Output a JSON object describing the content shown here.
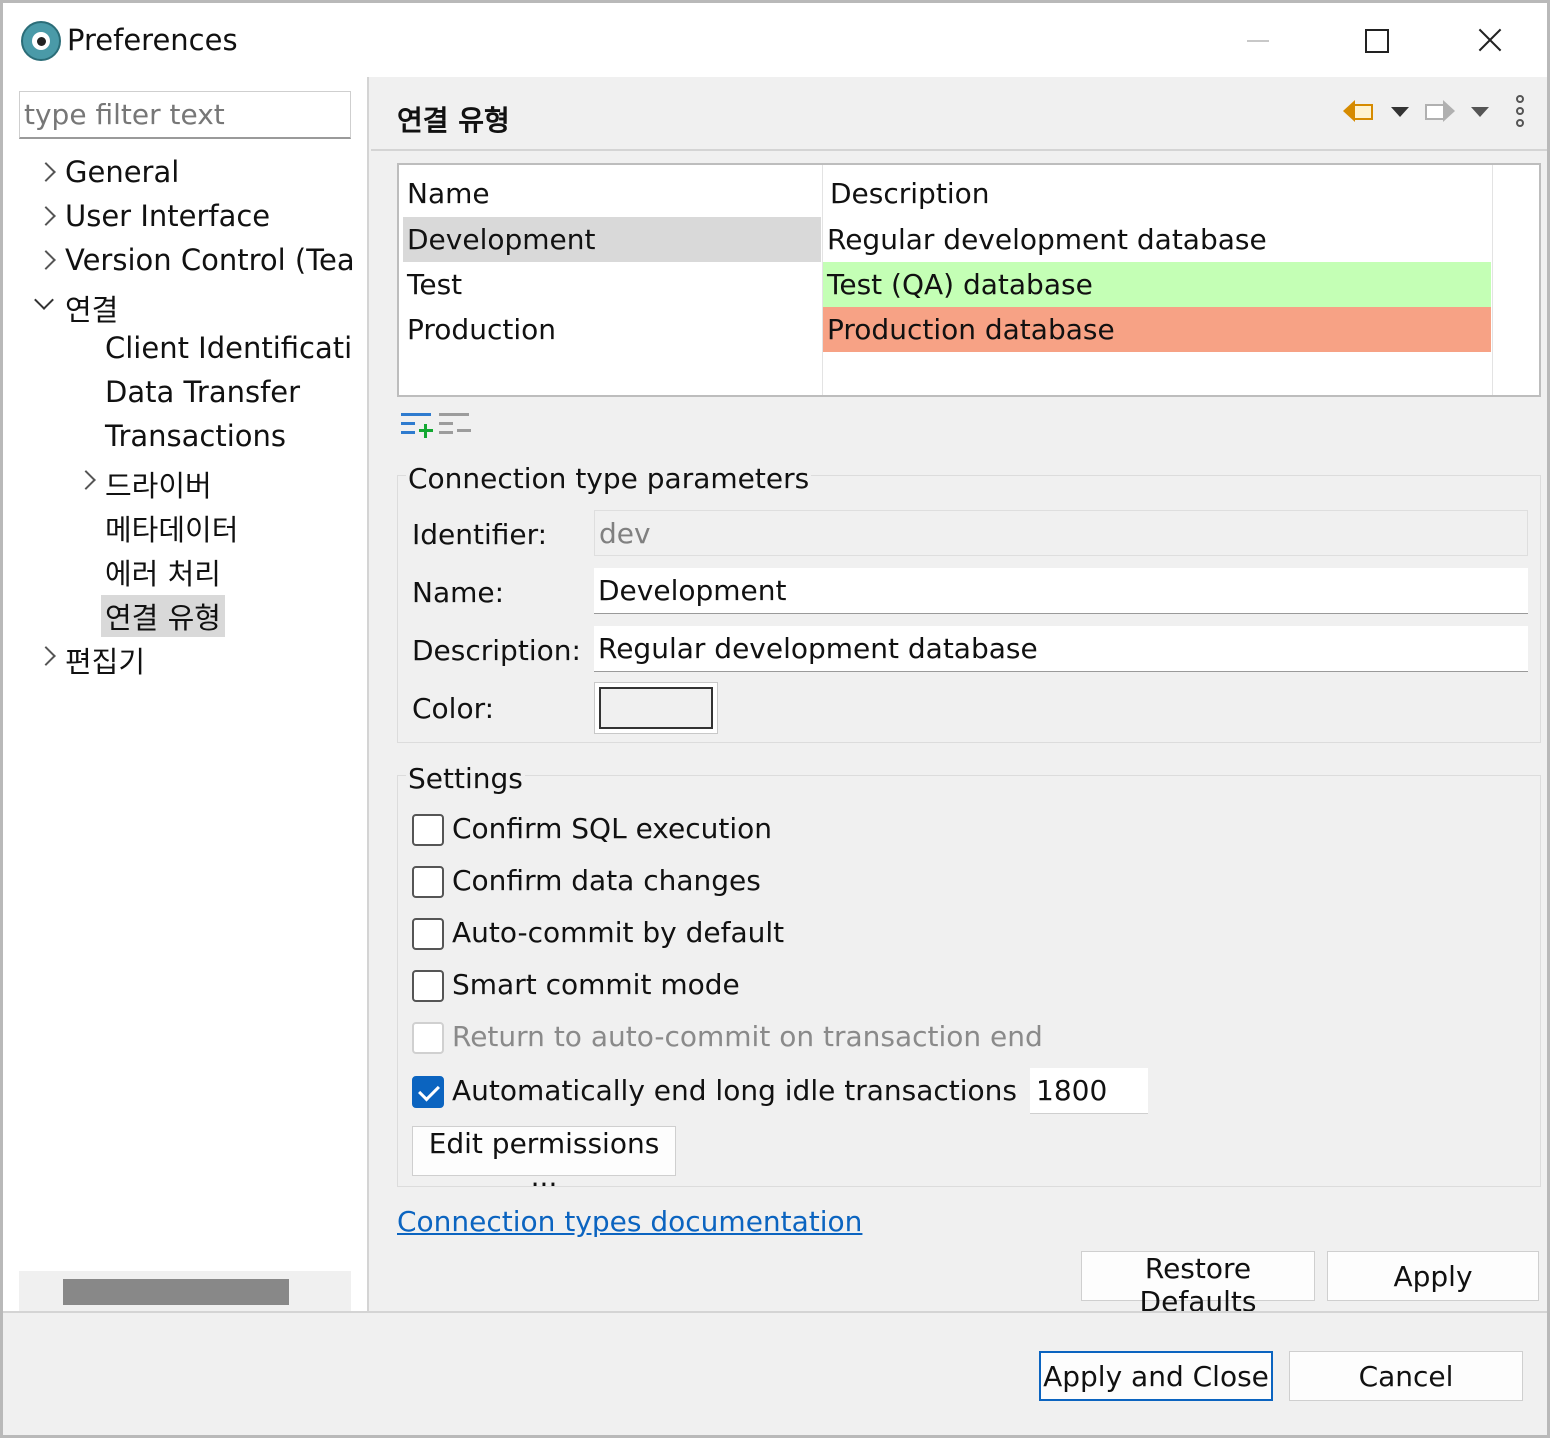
{
  "window": {
    "title": "Preferences"
  },
  "sidebar": {
    "filter_placeholder": "type filter text",
    "items": [
      {
        "label": "General"
      },
      {
        "label": "User Interface"
      },
      {
        "label": "Version Control (Tear"
      },
      {
        "label": "연결"
      },
      {
        "label": "Client Identificatio"
      },
      {
        "label": "Data Transfer"
      },
      {
        "label": "Transactions"
      },
      {
        "label": "드라이버"
      },
      {
        "label": "메타데이터"
      },
      {
        "label": "에러 처리"
      },
      {
        "label": "연결 유형"
      },
      {
        "label": "편집기"
      }
    ]
  },
  "page": {
    "title": "연결 유형"
  },
  "table": {
    "columns": [
      "Name",
      "Description"
    ],
    "rows": [
      {
        "name": "Development",
        "description": "Regular development database",
        "color": "#ffffff"
      },
      {
        "name": "Test",
        "description": "Test (QA) database",
        "color": "#c4ffb5"
      },
      {
        "name": "Production",
        "description": "Production database",
        "color": "#f7a285"
      }
    ]
  },
  "params": {
    "legend": "Connection type parameters",
    "identifier_label": "Identifier:",
    "identifier_value": "dev",
    "name_label": "Name:",
    "name_value": "Development",
    "description_label": "Description:",
    "description_value": "Regular development database",
    "color_label": "Color:"
  },
  "settings": {
    "legend": "Settings",
    "checks": [
      {
        "label": "Confirm SQL execution",
        "checked": false,
        "disabled": false
      },
      {
        "label": "Confirm data changes",
        "checked": false,
        "disabled": false
      },
      {
        "label": "Auto-commit by default",
        "checked": false,
        "disabled": false
      },
      {
        "label": "Smart commit mode",
        "checked": false,
        "disabled": false
      },
      {
        "label": "Return to auto-commit on transaction end",
        "checked": false,
        "disabled": true
      },
      {
        "label": "Automatically end long idle transactions",
        "checked": true,
        "disabled": false
      }
    ],
    "idle_timeout": "1800",
    "edit_permissions_label": "Edit permissions ..."
  },
  "link": {
    "label": "Connection types documentation"
  },
  "buttons": {
    "restore_defaults": "Restore Defaults",
    "apply": "Apply",
    "apply_and_close": "Apply and Close",
    "cancel": "Cancel"
  }
}
